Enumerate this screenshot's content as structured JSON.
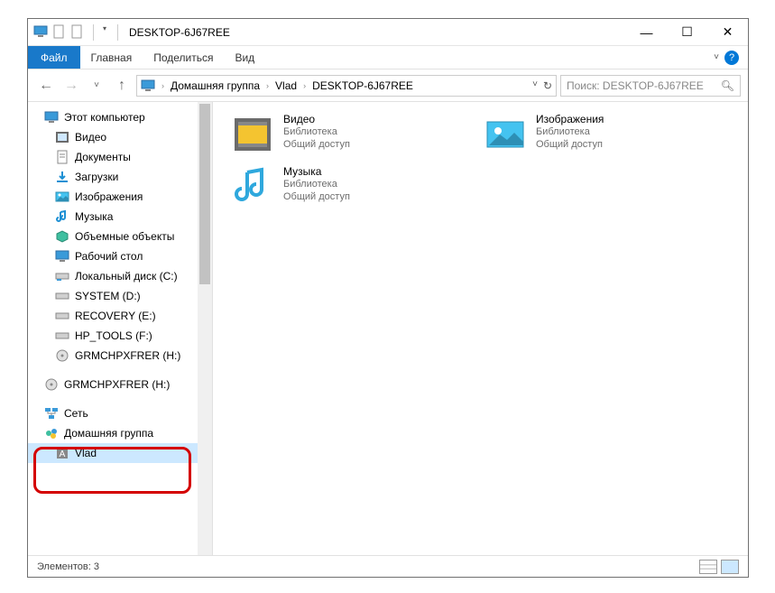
{
  "titlebar": {
    "title": "DESKTOP-6J67REE"
  },
  "window_controls": {
    "min": "—",
    "max": "☐",
    "close": "✕"
  },
  "ribbon": {
    "file": "Файл",
    "tabs": [
      "Главная",
      "Поделиться",
      "Вид"
    ]
  },
  "nav": {
    "back": "←",
    "forward": "→",
    "dropdown": "˅",
    "up": "↑"
  },
  "address": {
    "crumbs": [
      "Домашняя группа",
      "Vlad",
      "DESKTOP-6J67REE"
    ]
  },
  "searchbox": {
    "placeholder": "Поиск: DESKTOP-6J67REE"
  },
  "sidebar": {
    "root_label": "Этот компьютер",
    "items": [
      "Видео",
      "Документы",
      "Загрузки",
      "Изображения",
      "Музыка",
      "Объемные объекты",
      "Рабочий стол",
      "Локальный диск (C:)",
      "SYSTEM (D:)",
      "RECOVERY (E:)",
      "HP_TOOLS (F:)",
      "GRMCHPXFRER (H:)"
    ],
    "extra_drive": "GRMCHPXFRER (H:)",
    "network": "Сеть",
    "homegroup": "Домашняя группа",
    "user": "Vlad"
  },
  "main": {
    "items": [
      {
        "name": "Видео",
        "line1": "Библиотека",
        "line2": "Общий доступ"
      },
      {
        "name": "Изображения",
        "line1": "Библиотека",
        "line2": "Общий доступ"
      },
      {
        "name": "Музыка",
        "line1": "Библиотека",
        "line2": "Общий доступ"
      }
    ]
  },
  "statusbar": {
    "text": "Элементов: 3"
  }
}
